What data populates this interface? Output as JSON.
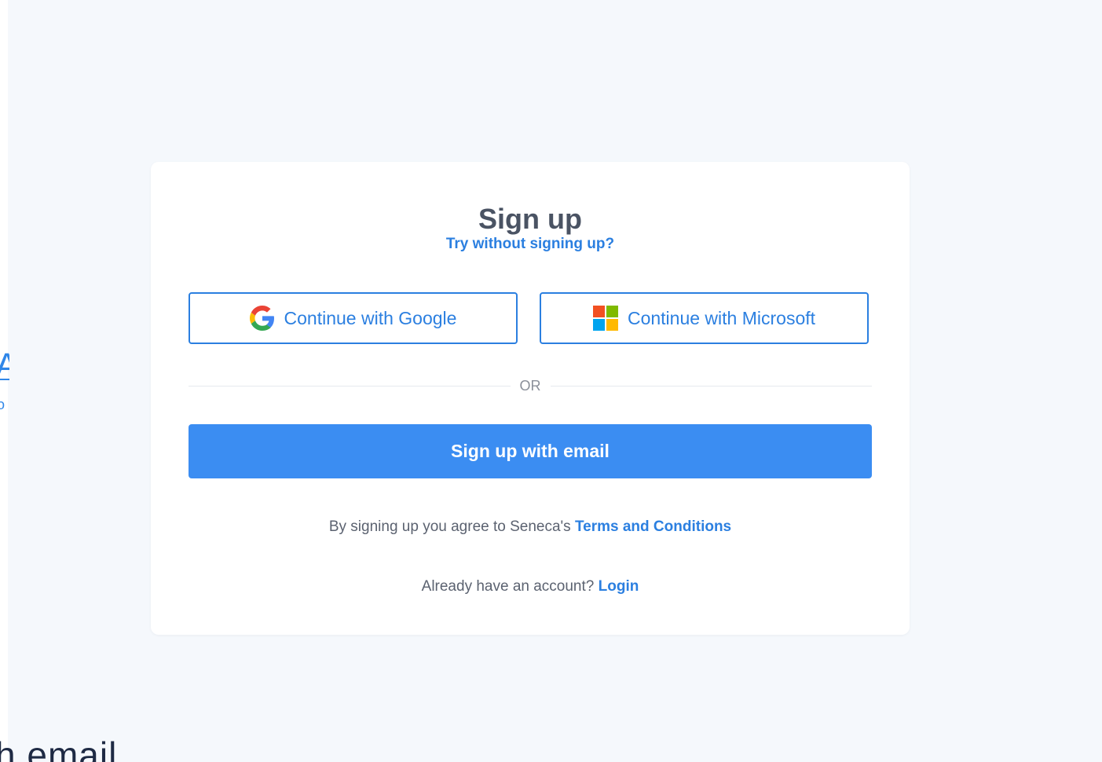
{
  "signup": {
    "title": "Sign up",
    "try_without": "Try without signing up?",
    "google_label": "Continue with Google",
    "microsoft_label": "Continue with Microsoft",
    "divider_text": "OR",
    "email_label": "Sign up with email",
    "terms_prefix": "By signing up you agree to Seneca's ",
    "terms_link": "Terms and Conditions",
    "login_prefix": "Already have an account? ",
    "login_link": "Login"
  },
  "background": {
    "partial_left_glyph": "A",
    "partial_left_small": "o",
    "partial_bottom_text": "h email"
  },
  "colors": {
    "accent": "#2b7fe0",
    "primary_button": "#3b8df2",
    "page_bg": "#f5f8fc",
    "card_bg": "#ffffff"
  },
  "icons": {
    "google": "google-g-icon",
    "microsoft": "microsoft-logo-icon"
  }
}
